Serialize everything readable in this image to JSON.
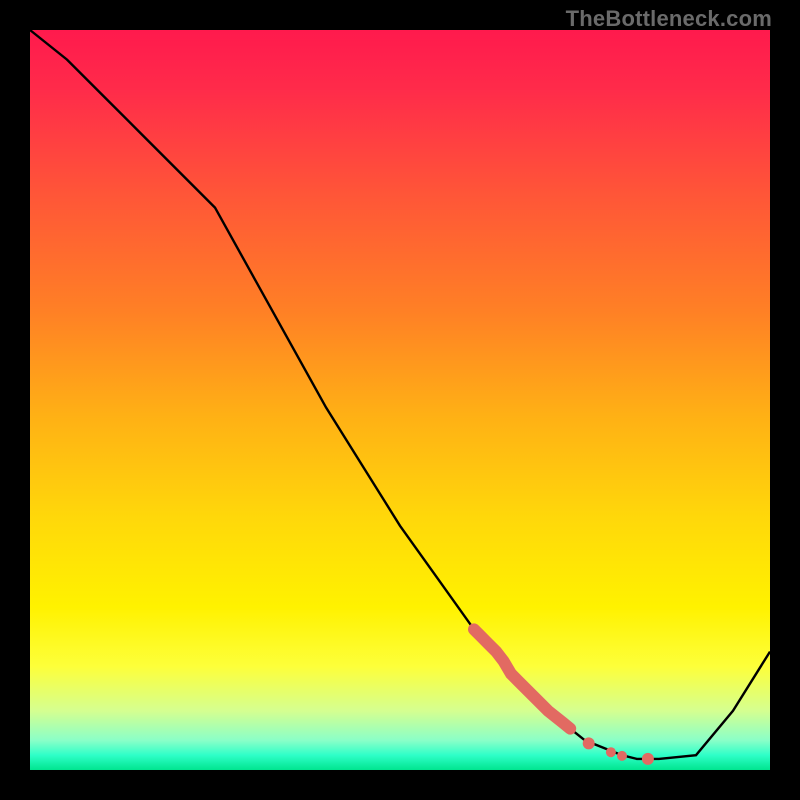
{
  "watermark": "TheBottleneck.com",
  "chart_data": {
    "type": "line",
    "title": "",
    "xlabel": "",
    "ylabel": "",
    "xlim": [
      0,
      100
    ],
    "ylim": [
      0,
      100
    ],
    "series": [
      {
        "name": "bottleneck-curve",
        "x": [
          0,
          5,
          10,
          15,
          20,
          25,
          30,
          35,
          40,
          45,
          50,
          55,
          60,
          65,
          70,
          75,
          80,
          82,
          85,
          90,
          95,
          100
        ],
        "y": [
          100,
          96,
          91,
          86,
          81,
          76,
          67,
          58,
          49,
          41,
          33,
          26,
          19,
          13,
          8,
          4,
          2,
          1.5,
          1.5,
          2,
          8,
          16
        ]
      }
    ],
    "highlight_segment": {
      "name": "thick-highlight",
      "color": "#e26a62",
      "x": [
        60,
        61,
        62,
        63,
        64,
        65,
        66,
        67,
        68,
        69,
        70,
        71,
        72,
        73
      ],
      "y": [
        19,
        18,
        17,
        16,
        14.7,
        13,
        12,
        11,
        10,
        9,
        8,
        7.2,
        6.4,
        5.6
      ]
    },
    "marker_dots": {
      "name": "baseline-dots",
      "color": "#e26a62",
      "points": [
        {
          "x": 75.5,
          "y": 3.6
        },
        {
          "x": 78.5,
          "y": 2.4
        },
        {
          "x": 80.0,
          "y": 1.9
        },
        {
          "x": 83.5,
          "y": 1.5
        }
      ]
    },
    "colors": {
      "curve": "#000000",
      "highlight": "#e26a62",
      "gradient_top": "#ff1a4d",
      "gradient_bottom": "#00e58f",
      "frame": "#000000"
    }
  }
}
